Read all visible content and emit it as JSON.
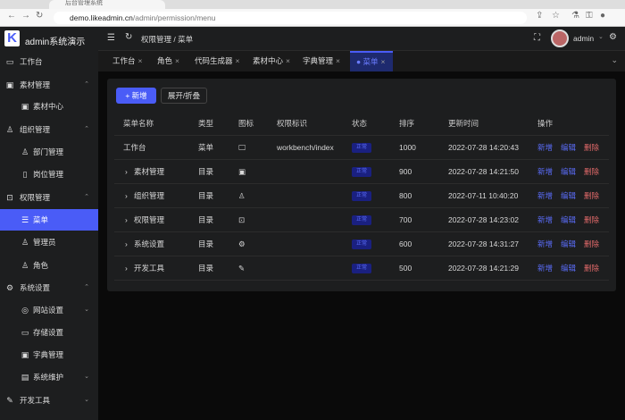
{
  "browser": {
    "tab_title": "后台管理系统",
    "url_domain": "demo.likeadmin.cn",
    "url_path": "/admin/permission/menu"
  },
  "app": {
    "brand": "admin系统演示",
    "logo": "K",
    "breadcrumb": [
      "权限管理",
      "菜单"
    ],
    "user": "admin"
  },
  "sidebar": [
    {
      "label": "工作台",
      "icon": "monitor-icon",
      "glyph": "▭",
      "level": 0
    },
    {
      "label": "素材管理",
      "icon": "image-icon",
      "glyph": "▣",
      "level": 0,
      "chev": "⌃"
    },
    {
      "label": "素材中心",
      "icon": "picture-icon",
      "glyph": "▣",
      "level": 1
    },
    {
      "label": "组织管理",
      "icon": "user-icon",
      "glyph": "♙",
      "level": 0,
      "chev": "⌃"
    },
    {
      "label": "部门管理",
      "icon": "user-icon",
      "glyph": "♙",
      "level": 1
    },
    {
      "label": "岗位管理",
      "icon": "clipboard-icon",
      "glyph": "▯",
      "level": 1
    },
    {
      "label": "权限管理",
      "icon": "lock-icon",
      "glyph": "⊡",
      "level": 0,
      "chev": "⌃"
    },
    {
      "label": "菜单",
      "icon": "sliders-icon",
      "glyph": "☰",
      "level": 1,
      "active": true
    },
    {
      "label": "管理员",
      "icon": "admin-icon",
      "glyph": "♙",
      "level": 1
    },
    {
      "label": "角色",
      "icon": "role-icon",
      "glyph": "♙",
      "level": 1
    },
    {
      "label": "系统设置",
      "icon": "gear-icon",
      "glyph": "⚙",
      "level": 0,
      "chev": "⌃"
    },
    {
      "label": "网站设置",
      "icon": "globe-icon",
      "glyph": "◎",
      "level": 1,
      "chev": "⌄"
    },
    {
      "label": "存储设置",
      "icon": "folder-icon",
      "glyph": "▭",
      "level": 1
    },
    {
      "label": "字典管理",
      "icon": "book-icon",
      "glyph": "▣",
      "level": 1
    },
    {
      "label": "系统维护",
      "icon": "tool-icon",
      "glyph": "▤",
      "level": 1,
      "chev": "⌄"
    },
    {
      "label": "开发工具",
      "icon": "pen-icon",
      "glyph": "✎",
      "level": 0,
      "chev": "⌄"
    }
  ],
  "tabs": [
    {
      "label": "工作台"
    },
    {
      "label": "角色"
    },
    {
      "label": "代码生成器"
    },
    {
      "label": "素材中心"
    },
    {
      "label": "字典管理"
    },
    {
      "label": "● 菜单",
      "active": true
    }
  ],
  "toolbar": {
    "add": "+ 新增",
    "toggle": "展开/折叠"
  },
  "table": {
    "headers": [
      "菜单名称",
      "类型",
      "图标",
      "权限标识",
      "状态",
      "排序",
      "更新时间",
      "操作"
    ],
    "rows": [
      {
        "name": "工作台",
        "expand": "",
        "type": "菜单",
        "icon": "monitor-icon",
        "glyph": "🖵",
        "perm": "workbench/index",
        "status": "正常",
        "sort": "1000",
        "time": "2022-07-28 14:20:43"
      },
      {
        "name": "素材管理",
        "expand": "›",
        "type": "目录",
        "icon": "image-icon",
        "glyph": "▣",
        "perm": "",
        "status": "正常",
        "sort": "900",
        "time": "2022-07-28 14:21:50"
      },
      {
        "name": "组织管理",
        "expand": "›",
        "type": "目录",
        "icon": "user-icon",
        "glyph": "♙",
        "perm": "",
        "status": "正常",
        "sort": "800",
        "time": "2022-07-11 10:40:20"
      },
      {
        "name": "权限管理",
        "expand": "›",
        "type": "目录",
        "icon": "lock-icon",
        "glyph": "⊡",
        "perm": "",
        "status": "正常",
        "sort": "700",
        "time": "2022-07-28 14:23:02"
      },
      {
        "name": "系统设置",
        "expand": "›",
        "type": "目录",
        "icon": "gear-icon",
        "glyph": "⚙",
        "perm": "",
        "status": "正常",
        "sort": "600",
        "time": "2022-07-28 14:31:27"
      },
      {
        "name": "开发工具",
        "expand": "›",
        "type": "目录",
        "icon": "pen-icon",
        "glyph": "✎",
        "perm": "",
        "status": "正常",
        "sort": "500",
        "time": "2022-07-28 14:21:29"
      }
    ],
    "ops": [
      "新增",
      "编辑",
      "删除"
    ]
  }
}
